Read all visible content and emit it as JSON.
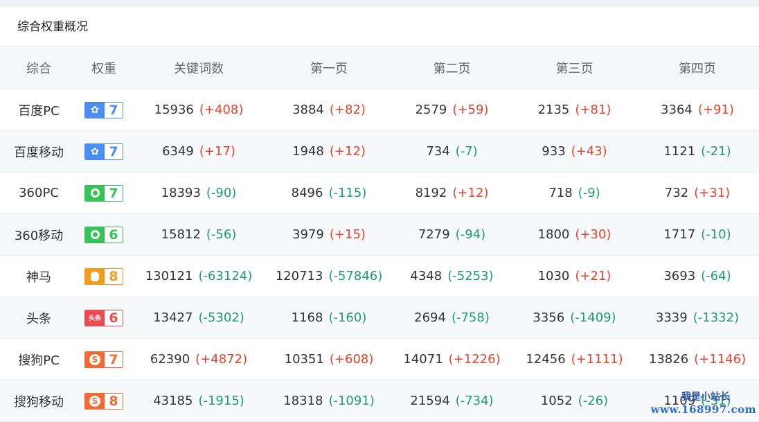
{
  "panel": {
    "title": "综合权重概况"
  },
  "columns": [
    "综合",
    "权重",
    "关键词数",
    "第一页",
    "第二页",
    "第三页",
    "第四页"
  ],
  "badge_colors": {
    "baidu": "#4a8df5",
    "q360": "#36c35a",
    "shenma": "#f59a1b",
    "toutiao": "#ef4a4f",
    "sogou": "#f26a32"
  },
  "rows": [
    {
      "name": "百度PC",
      "engine": "baidu",
      "icon": "baidu-paw-icon",
      "weight": "7",
      "cells": [
        {
          "v": "15936",
          "d": "(+408)",
          "s": "up"
        },
        {
          "v": "3884",
          "d": "(+82)",
          "s": "up"
        },
        {
          "v": "2579",
          "d": "(+59)",
          "s": "up"
        },
        {
          "v": "2135",
          "d": "(+81)",
          "s": "up"
        },
        {
          "v": "3364",
          "d": "(+91)",
          "s": "up"
        }
      ]
    },
    {
      "name": "百度移动",
      "engine": "baidu",
      "icon": "baidu-paw-icon",
      "weight": "7",
      "cells": [
        {
          "v": "6349",
          "d": "(+17)",
          "s": "up"
        },
        {
          "v": "1948",
          "d": "(+12)",
          "s": "up"
        },
        {
          "v": "734",
          "d": "(-7)",
          "s": "down"
        },
        {
          "v": "933",
          "d": "(+43)",
          "s": "up"
        },
        {
          "v": "1121",
          "d": "(-21)",
          "s": "down"
        }
      ]
    },
    {
      "name": "360PC",
      "engine": "q360",
      "icon": "360-logo-icon",
      "weight": "7",
      "cells": [
        {
          "v": "18393",
          "d": "(-90)",
          "s": "down"
        },
        {
          "v": "8496",
          "d": "(-115)",
          "s": "down"
        },
        {
          "v": "8192",
          "d": "(+12)",
          "s": "up"
        },
        {
          "v": "718",
          "d": "(-9)",
          "s": "down"
        },
        {
          "v": "732",
          "d": "(+31)",
          "s": "up"
        }
      ]
    },
    {
      "name": "360移动",
      "engine": "q360",
      "icon": "360-logo-icon",
      "weight": "6",
      "cells": [
        {
          "v": "15812",
          "d": "(-56)",
          "s": "down"
        },
        {
          "v": "3979",
          "d": "(+15)",
          "s": "up"
        },
        {
          "v": "7279",
          "d": "(-94)",
          "s": "down"
        },
        {
          "v": "1800",
          "d": "(+30)",
          "s": "up"
        },
        {
          "v": "1717",
          "d": "(-10)",
          "s": "down"
        }
      ]
    },
    {
      "name": "神马",
      "engine": "shenma",
      "icon": "shenma-logo-icon",
      "weight": "8",
      "cells": [
        {
          "v": "130121",
          "d": "(-63124)",
          "s": "down"
        },
        {
          "v": "120713",
          "d": "(-57846)",
          "s": "down"
        },
        {
          "v": "4348",
          "d": "(-5253)",
          "s": "down"
        },
        {
          "v": "1030",
          "d": "(+21)",
          "s": "up"
        },
        {
          "v": "3693",
          "d": "(-64)",
          "s": "down"
        }
      ]
    },
    {
      "name": "头条",
      "engine": "toutiao",
      "icon": "toutiao-logo-icon",
      "weight": "6",
      "cells": [
        {
          "v": "13427",
          "d": "(-5302)",
          "s": "down"
        },
        {
          "v": "1168",
          "d": "(-160)",
          "s": "down"
        },
        {
          "v": "2694",
          "d": "(-758)",
          "s": "down"
        },
        {
          "v": "3356",
          "d": "(-1409)",
          "s": "down"
        },
        {
          "v": "3339",
          "d": "(-1332)",
          "s": "down"
        }
      ]
    },
    {
      "name": "搜狗PC",
      "engine": "sogou",
      "icon": "sogou-logo-icon",
      "weight": "7",
      "cells": [
        {
          "v": "62390",
          "d": "(+4872)",
          "s": "up"
        },
        {
          "v": "10351",
          "d": "(+608)",
          "s": "up"
        },
        {
          "v": "14071",
          "d": "(+1226)",
          "s": "up"
        },
        {
          "v": "12456",
          "d": "(+1111)",
          "s": "up"
        },
        {
          "v": "13826",
          "d": "(+1146)",
          "s": "up"
        }
      ]
    },
    {
      "name": "搜狗移动",
      "engine": "sogou",
      "icon": "sogou-logo-icon",
      "weight": "8",
      "cells": [
        {
          "v": "43185",
          "d": "(-1915)",
          "s": "down"
        },
        {
          "v": "18318",
          "d": "(-1091)",
          "s": "down"
        },
        {
          "v": "21594",
          "d": "(-734)",
          "s": "down"
        },
        {
          "v": "1052",
          "d": "(-26)",
          "s": "down"
        },
        {
          "v": "1109",
          "d": "(-31)",
          "s": "down"
        }
      ]
    }
  ],
  "badge_text": {
    "toutiao": "头条"
  },
  "watermark": {
    "line1": "我是小站长",
    "line2": "www.168997.com"
  }
}
